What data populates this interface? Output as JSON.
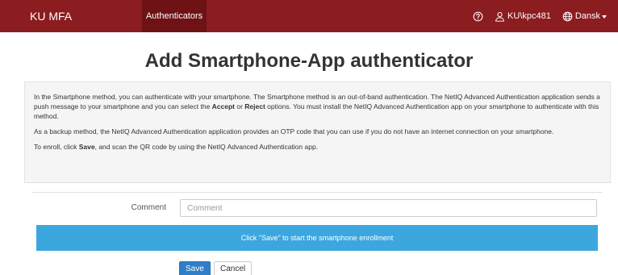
{
  "navbar": {
    "brand": "KU MFA",
    "tab": "Authenticators",
    "help_icon": "help-circle-icon",
    "user_icon": "user-icon",
    "user": "KU\\kpc481",
    "language_icon": "globe-icon",
    "language": "Dansk",
    "bg_color": "#8b1c1f",
    "active_tab_color": "#6e1215"
  },
  "title": {
    "prefix": "Add ",
    "bold": "Smartphone-App",
    "suffix": " authenticator"
  },
  "info": {
    "p1_a": "In the Smartphone method, you can authenticate with your smartphone. The Smartphone method is an out-of-band authentication. The NetIQ Advanced Authentication application sends a push message to your smartphone and you can select the ",
    "p1_accept": "Accept",
    "p1_or": " or ",
    "p1_reject": "Reject",
    "p1_b": " options. You must install the NetIQ Advanced Authentication app on your smartphone to authenticate with this method.",
    "p2": "As a backup method, the NetIQ Advanced Authentication application provides an OTP code that you can use if you do not have an internet connection on your smartphone.",
    "p3_a": "To enroll, click ",
    "p3_save": "Save",
    "p3_b": ", and scan the QR code by using the NetIQ Advanced Authentication app."
  },
  "form": {
    "comment_label": "Comment",
    "comment_placeholder": "Comment",
    "comment_value": ""
  },
  "alert": {
    "text": "Click \"Save\" to start the smartphone enrollment",
    "color": "#3ba7de"
  },
  "buttons": {
    "save": "Save",
    "cancel": "Cancel"
  }
}
